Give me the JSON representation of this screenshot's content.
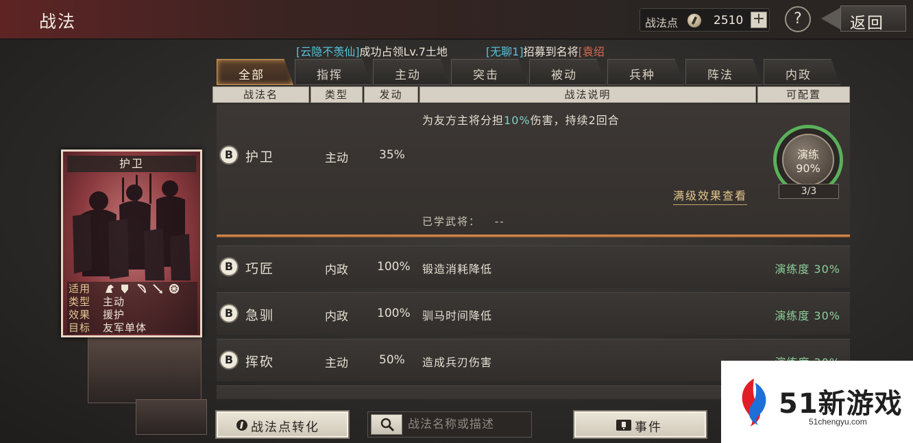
{
  "header": {
    "title": "战法",
    "points_label": "战法点",
    "points_value": "2510",
    "plus_label": "+",
    "help_label": "?",
    "back_label": "返回"
  },
  "ticker": [
    {
      "text": "[云隐不羡仙]",
      "color": "cyan"
    },
    {
      "text": "成功占领Lv.7土地",
      "color": "white"
    },
    {
      "text": "[无聊1]",
      "color": "cyan"
    },
    {
      "text": "招募到名将",
      "color": "white"
    },
    {
      "text": "[袁绍",
      "color": "red"
    }
  ],
  "tabs": [
    {
      "label": "全部",
      "active": true
    },
    {
      "label": "指挥",
      "active": false
    },
    {
      "label": "主动",
      "active": false
    },
    {
      "label": "突击",
      "active": false
    },
    {
      "label": "被动",
      "active": false
    },
    {
      "label": "兵种",
      "active": false
    },
    {
      "label": "阵法",
      "active": false
    },
    {
      "label": "内政",
      "active": false
    }
  ],
  "columns": {
    "name": "战法名",
    "type": "类型",
    "trigger": "发动",
    "desc": "战法说明",
    "config": "可配置"
  },
  "selected": {
    "grade": "B",
    "name": "护卫",
    "type": "主动",
    "rate": "35%",
    "desc_pre": "为友方主将分担",
    "desc_hl": "10%",
    "desc_post": "伤害，持续2回合",
    "full_effect_label": "满级效果查看",
    "learned_label": "已学武将：",
    "learned_value": "--",
    "training": {
      "label": "演练",
      "percent": "90%",
      "count": "3/3"
    }
  },
  "rows": [
    {
      "grade": "B",
      "name": "巧匠",
      "type": "内政",
      "rate": "100%",
      "desc": "锻造消耗降低",
      "training": "演练度 30%"
    },
    {
      "grade": "B",
      "name": "急驯",
      "type": "内政",
      "rate": "100%",
      "desc": "驯马时间降低",
      "training": "演练度 30%"
    },
    {
      "grade": "B",
      "name": "挥砍",
      "type": "主动",
      "rate": "50%",
      "desc": "造成兵刃伤害",
      "training": "演练度 30%"
    }
  ],
  "card": {
    "name": "护卫",
    "applicable_label": "适用",
    "applicable_icons": [
      "cavalry-icon",
      "shield-icon",
      "bow-icon",
      "spear-icon",
      "wheel-icon"
    ],
    "type_label": "类型",
    "type_value": "主动",
    "effect_label": "效果",
    "effect_value": "援护",
    "target_label": "目标",
    "target_value": "友军单体"
  },
  "bottom": {
    "convert_label": "战法点转化",
    "search_placeholder": "战法名称或描述",
    "event_label": "事件"
  },
  "watermark": {
    "text": "51新游戏",
    "url": "51chengyu.com"
  },
  "colors": {
    "accent_tab": "#c99a5c",
    "highlight": "#7fd1c8",
    "training_green": "#5bb05a",
    "ticker_cyan": "#53c3dc",
    "ticker_red": "#d96f52"
  }
}
